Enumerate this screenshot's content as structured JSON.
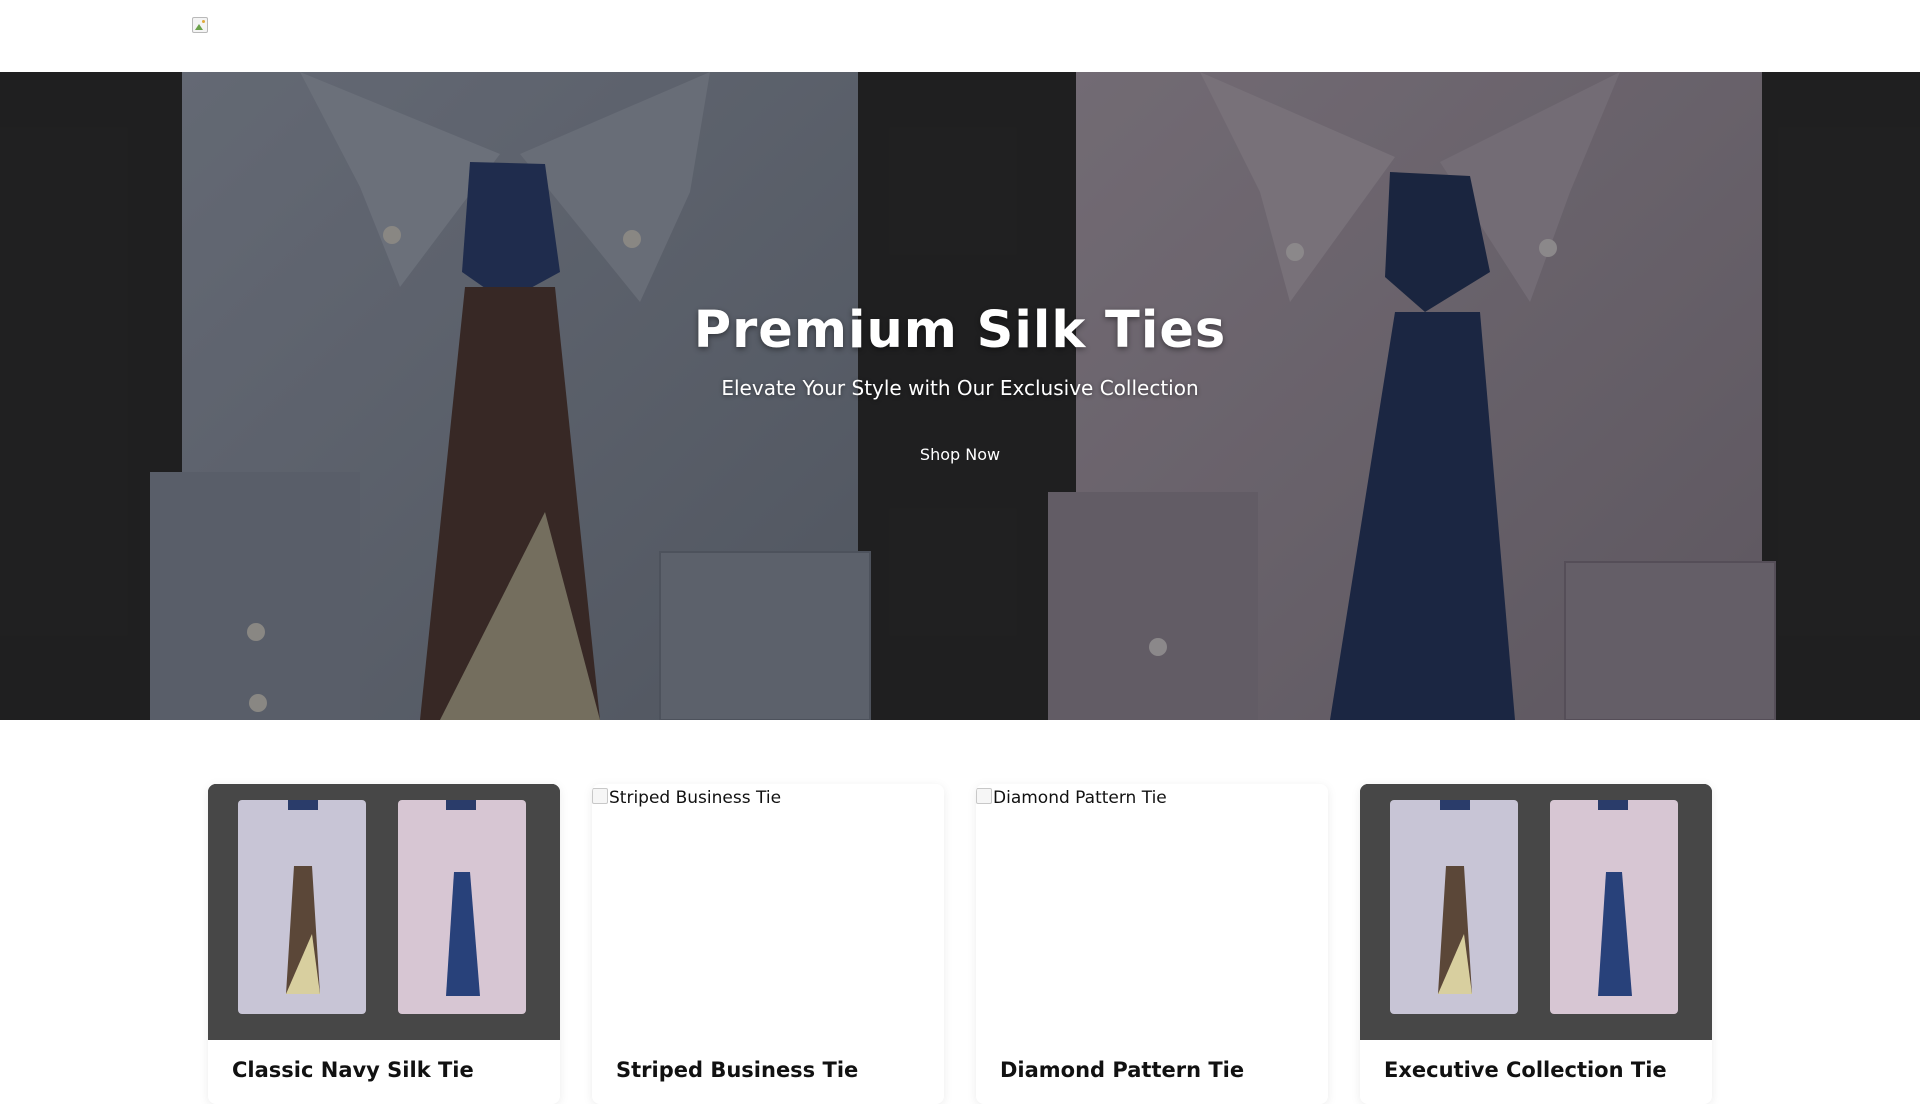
{
  "header": {
    "logo_alt": ""
  },
  "hero": {
    "title": "Premium Silk Ties",
    "subtitle": "Elevate Your Style with Our Exclusive Collection",
    "cta_label": "Shop Now"
  },
  "products": [
    {
      "title": "Classic Navy Silk Tie",
      "image_alt": "Classic Navy Silk Tie",
      "image_loaded": true
    },
    {
      "title": "Striped Business Tie",
      "image_alt": "Striped Business Tie",
      "image_loaded": false
    },
    {
      "title": "Diamond Pattern Tie",
      "image_alt": "Diamond Pattern Tie",
      "image_loaded": false
    },
    {
      "title": "Executive Collection Tie",
      "image_alt": "Executive Collection Tie",
      "image_loaded": true
    }
  ],
  "colors": {
    "hero_background": "#262626",
    "card_image_background": "#474747",
    "text_primary": "#111111",
    "text_inverse": "#ffffff"
  }
}
